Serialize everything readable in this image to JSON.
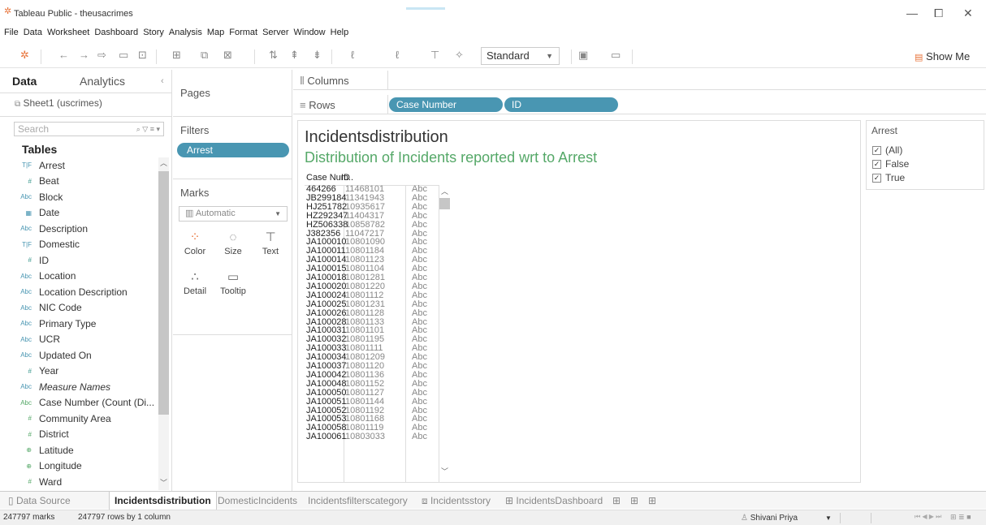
{
  "window": {
    "title": "Tableau Public - theusacrimes",
    "minimize": "—",
    "restore": "⧠",
    "close": "✕"
  },
  "menu": [
    "File",
    "Data",
    "Worksheet",
    "Dashboard",
    "Story",
    "Analysis",
    "Map",
    "Format",
    "Server",
    "Window",
    "Help"
  ],
  "toolbar": {
    "fit_mode": "Standard",
    "show_me": "Show Me"
  },
  "data_pane": {
    "tab_data": "Data",
    "tab_analytics": "Analytics",
    "datasource": "Sheet1 (uscrimes)",
    "search_placeholder": "Search",
    "tables_label": "Tables",
    "fields": [
      {
        "type": "T|F",
        "name": "Arrest"
      },
      {
        "type": "#",
        "name": "Beat"
      },
      {
        "type": "Abc",
        "name": "Block"
      },
      {
        "type": "date",
        "name": "Date"
      },
      {
        "type": "Abc",
        "name": "Description"
      },
      {
        "type": "T|F",
        "name": "Domestic"
      },
      {
        "type": "#",
        "name": "ID"
      },
      {
        "type": "Abc",
        "name": "Location"
      },
      {
        "type": "Abc",
        "name": "Location Description"
      },
      {
        "type": "Abc",
        "name": "NIC Code"
      },
      {
        "type": "Abc",
        "name": "Primary Type"
      },
      {
        "type": "Abc",
        "name": "UCR"
      },
      {
        "type": "Abc",
        "name": "Updated On"
      },
      {
        "type": "#",
        "name": "Year"
      },
      {
        "type": "Abc",
        "name": "Measure Names"
      },
      {
        "type": "Abc",
        "name": "Case Number (Count (Di..."
      },
      {
        "type": "#",
        "name": "Community Area"
      },
      {
        "type": "#",
        "name": "District"
      },
      {
        "type": "geo",
        "name": "Latitude"
      },
      {
        "type": "geo",
        "name": "Longitude"
      },
      {
        "type": "#",
        "name": "Ward"
      }
    ]
  },
  "cards": {
    "pages": "Pages",
    "filters": "Filters",
    "filter_pill": "Arrest",
    "marks": "Marks",
    "mark_type": "Automatic",
    "mark_buttons": [
      "Color",
      "Size",
      "Text",
      "Detail",
      "Tooltip"
    ]
  },
  "shelves": {
    "columns_label": "Columns",
    "rows_label": "Rows",
    "row_pills": [
      "Case Number",
      "ID"
    ]
  },
  "view": {
    "title": "Incidentsdistribution",
    "subtitle": "Distribution of Incidents reported wrt to Arrest",
    "header_case": "Case Num..",
    "header_id": "ID",
    "rows": [
      {
        "case": "464266",
        "id": "11468101",
        "val": "Abc"
      },
      {
        "case": "JB299184",
        "id": "11341943",
        "val": "Abc"
      },
      {
        "case": "HJ251782",
        "id": "10935617",
        "val": "Abc"
      },
      {
        "case": "HZ292347",
        "id": "11404317",
        "val": "Abc"
      },
      {
        "case": "HZ506338",
        "id": "10858782",
        "val": "Abc"
      },
      {
        "case": "J382356",
        "id": "11047217",
        "val": "Abc"
      },
      {
        "case": "JA100010",
        "id": "10801090",
        "val": "Abc"
      },
      {
        "case": "JA100011",
        "id": "10801184",
        "val": "Abc"
      },
      {
        "case": "JA100014",
        "id": "10801123",
        "val": "Abc"
      },
      {
        "case": "JA100015",
        "id": "10801104",
        "val": "Abc"
      },
      {
        "case": "JA100018",
        "id": "10801281",
        "val": "Abc"
      },
      {
        "case": "JA100020",
        "id": "10801220",
        "val": "Abc"
      },
      {
        "case": "JA100024",
        "id": "10801112",
        "val": "Abc"
      },
      {
        "case": "JA100025",
        "id": "10801231",
        "val": "Abc"
      },
      {
        "case": "JA100026",
        "id": "10801128",
        "val": "Abc"
      },
      {
        "case": "JA100028",
        "id": "10801133",
        "val": "Abc"
      },
      {
        "case": "JA100031",
        "id": "10801101",
        "val": "Abc"
      },
      {
        "case": "JA100032",
        "id": "10801195",
        "val": "Abc"
      },
      {
        "case": "JA100033",
        "id": "10801111",
        "val": "Abc"
      },
      {
        "case": "JA100034",
        "id": "10801209",
        "val": "Abc"
      },
      {
        "case": "JA100037",
        "id": "10801120",
        "val": "Abc"
      },
      {
        "case": "JA100042",
        "id": "10801136",
        "val": "Abc"
      },
      {
        "case": "JA100048",
        "id": "10801152",
        "val": "Abc"
      },
      {
        "case": "JA100050",
        "id": "10801127",
        "val": "Abc"
      },
      {
        "case": "JA100051",
        "id": "10801144",
        "val": "Abc"
      },
      {
        "case": "JA100052",
        "id": "10801192",
        "val": "Abc"
      },
      {
        "case": "JA100053",
        "id": "10801168",
        "val": "Abc"
      },
      {
        "case": "JA100058",
        "id": "10801119",
        "val": "Abc"
      },
      {
        "case": "JA100061",
        "id": "10803033",
        "val": "Abc"
      }
    ]
  },
  "legend": {
    "title": "Arrest",
    "items": [
      "(All)",
      "False",
      "True"
    ]
  },
  "sheet_tabs": {
    "data_source": "Data Source",
    "tabs": [
      "Incidentsdistribution",
      "DomesticIncidents",
      "Incidentsfilterscategory",
      "Incidentsstory",
      "IncidentsDashboard"
    ],
    "active": "Incidentsdistribution"
  },
  "status": {
    "marks": "247797 marks",
    "rows_cols": "247797 rows by 1 column",
    "user": "Shivani Priya"
  },
  "colors": {
    "pill": "#4996b2",
    "subtitle": "#55a868",
    "accent": "#e8743b"
  }
}
